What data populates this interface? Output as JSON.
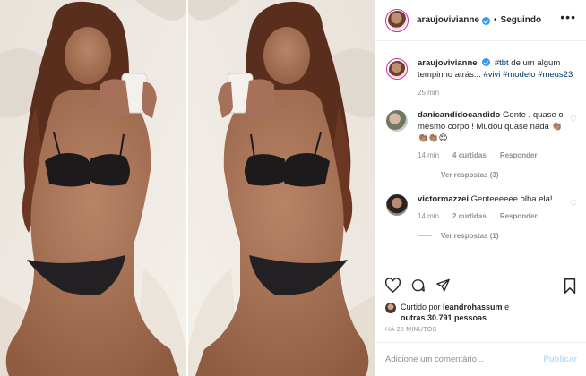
{
  "post": {
    "author": "araujovivianne",
    "separator": "•",
    "follow_label": "Seguindo",
    "more_icon": "more-options-icon"
  },
  "caption": {
    "username": "araujovivianne",
    "text_parts": [
      "#tbt",
      " de um algum tempinho atrás... ",
      "#vivi",
      " ",
      "#modelo",
      " ",
      "#meus23"
    ],
    "time": "25 min"
  },
  "comments": [
    {
      "username": "danicandidocandido",
      "text": "Gente . quase o mesmo corpo ! Mudou quase nada 👏🏽👏🏽👏🏽😍",
      "time": "14 min",
      "likes": "4 curtidas",
      "reply": "Responder",
      "view_replies": "Ver respostas (3)"
    },
    {
      "username": "victormazzei",
      "text": "Genteeeeee olha ela!",
      "time": "14 min",
      "likes": "2 curtidas",
      "reply": "Responder",
      "view_replies": "Ver respostas (1)"
    }
  ],
  "likes": {
    "prefix": "Curtido por ",
    "user": "leandrohassum",
    "middle": " e",
    "others": "outras 30.791 pessoas"
  },
  "timestamp": "HÁ 25 MINUTOS",
  "composer": {
    "placeholder": "Adicione um comentário...",
    "publish_label": "Publicar"
  },
  "colors": {
    "link": "#003569",
    "verified": "#3897f0",
    "muted": "#8e8e8e",
    "publish_disabled": "#b2dffc"
  }
}
